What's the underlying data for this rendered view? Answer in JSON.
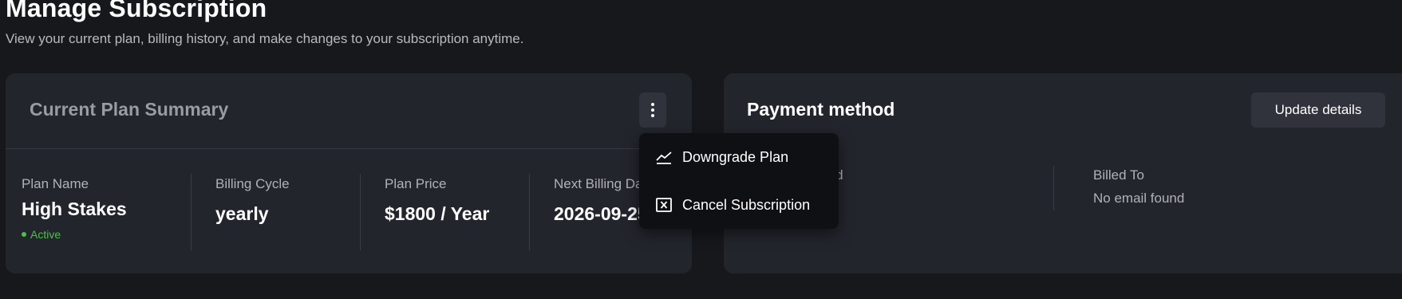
{
  "page": {
    "title": "Manage Subscription",
    "subtitle": "View your current plan, billing history, and make changes to your subscription anytime."
  },
  "plan_card": {
    "title": "Current Plan Summary",
    "columns": [
      {
        "label": "Plan Name",
        "value": "High Stakes"
      },
      {
        "label": "Billing Cycle",
        "value": "yearly"
      },
      {
        "label": "Plan Price",
        "value": "$1800 / Year"
      },
      {
        "label": "Next Billing Date",
        "value": "2026-09-25"
      }
    ],
    "status": "Active",
    "status_color": "#4cc04c"
  },
  "dropdown": {
    "items": [
      {
        "label": "Downgrade Plan",
        "icon": "trend-chart-icon"
      },
      {
        "label": "Cancel Subscription",
        "icon": "close-box-icon"
      }
    ]
  },
  "payment_card": {
    "title": "Payment method",
    "update_label": "Update details",
    "card_label_partial": "ard",
    "billed_to_label": "Billed To",
    "billed_to_value": "No email found"
  }
}
